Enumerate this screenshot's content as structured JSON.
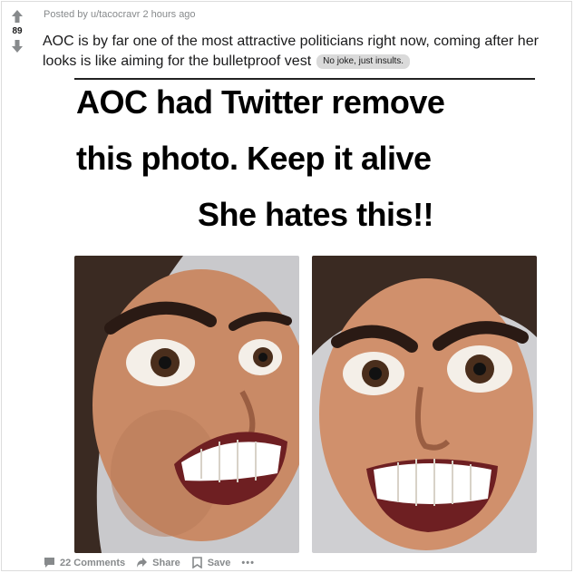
{
  "post": {
    "meta": "Posted by u/tacocravr 2 hours ago",
    "score": "89",
    "title": "AOC is by far one of the most attractive politicians right now, coming after her looks is like aiming for the bulletproof vest",
    "flair": "No joke, just insults."
  },
  "meme": {
    "line1": "AOC had Twitter remove",
    "line2": "this photo. Keep it alive",
    "line3": "She hates this!!"
  },
  "actions": {
    "comments": "22 Comments",
    "share": "Share",
    "save": "Save",
    "more": "•••"
  },
  "icons": {
    "upvote": "arrow-up-icon",
    "downvote": "arrow-down-icon",
    "comments": "comment-bubble-icon",
    "share": "share-arrow-icon",
    "save": "bookmark-icon"
  },
  "colors": {
    "meta_text": "#878a8c",
    "flair_bg": "#dadada"
  }
}
